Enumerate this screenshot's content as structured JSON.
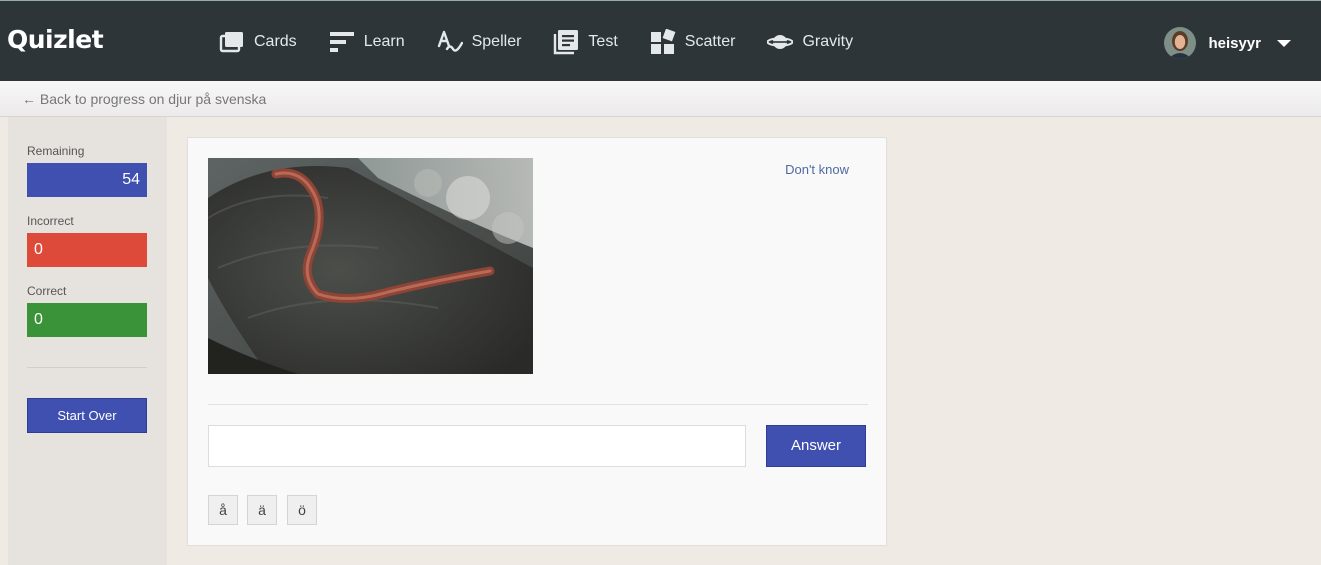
{
  "app": {
    "logo": "Quizlet"
  },
  "nav": {
    "items": [
      {
        "label": "Cards",
        "icon": "cards-icon"
      },
      {
        "label": "Learn",
        "icon": "learn-icon"
      },
      {
        "label": "Speller",
        "icon": "speller-icon"
      },
      {
        "label": "Test",
        "icon": "test-icon"
      },
      {
        "label": "Scatter",
        "icon": "scatter-icon"
      },
      {
        "label": "Gravity",
        "icon": "gravity-icon"
      }
    ]
  },
  "user": {
    "name": "heisyyr"
  },
  "back": {
    "label": "← Back to progress on djur på svenska"
  },
  "stats": {
    "remaining_label": "Remaining",
    "remaining_value": "54",
    "incorrect_label": "Incorrect",
    "incorrect_value": "0",
    "correct_label": "Correct",
    "correct_value": "0"
  },
  "sidebar": {
    "start_over_label": "Start Over"
  },
  "card": {
    "dont_know_label": "Don't know",
    "answer_value": "",
    "answer_label": "Answer",
    "special_chars": [
      "å",
      "ä",
      "ö"
    ]
  },
  "colors": {
    "topbar": "#2d3539",
    "primary": "#3f50b0",
    "incorrect": "#dd4a3a",
    "correct": "#3a9338"
  }
}
